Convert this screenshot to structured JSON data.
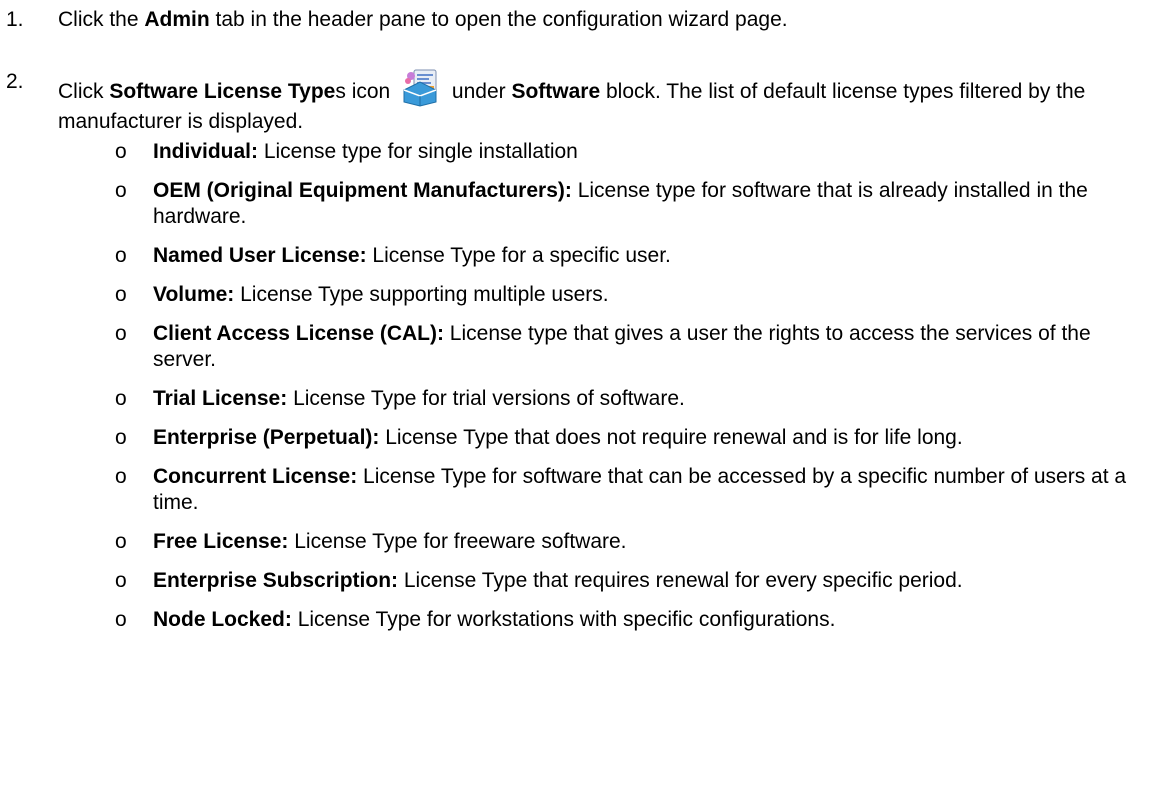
{
  "steps": [
    {
      "number": "1.",
      "pre": "Click the ",
      "bold1": "Admin",
      "post": " tab in the header pane to open the configuration wizard page."
    },
    {
      "number": "2.",
      "pre": "Click ",
      "bold1": "Software License Type",
      "mid1": "s icon ",
      "icon": "software-license-types-icon",
      "mid2": " under ",
      "bold2": "Software",
      "post": " block. The list of default license types filtered by the manufacturer is displayed."
    }
  ],
  "bullet_char": "o",
  "license_types": [
    {
      "term": "Individual:",
      "desc": " License type for single installation"
    },
    {
      "term": "OEM (Original Equipment Manufacturers):",
      "desc": " License type for software that is already installed in the hardware."
    },
    {
      "term": "Named User License:",
      "desc": " License Type for a specific user."
    },
    {
      "term": "Volume:",
      "desc": " License Type supporting multiple users."
    },
    {
      "term": "Client Access License (CAL):",
      "desc": " License type that gives a user the rights to access the services of the server."
    },
    {
      "term": "Trial License:",
      "desc": " License Type for trial versions of software."
    },
    {
      "term": "Enterprise (Perpetual):",
      "desc": " License Type that does not require renewal and is for life long."
    },
    {
      "term": "Concurrent License:",
      "desc": " License Type for software that can be accessed by a specific number of users at a time."
    },
    {
      "term": "Free License:",
      "desc": " License Type for freeware software."
    },
    {
      "term": "Enterprise Subscription:",
      "desc": " License Type that requires renewal for every specific period."
    },
    {
      "term": "Node Locked:",
      "desc": " License Type for workstations with specific configurations."
    }
  ]
}
